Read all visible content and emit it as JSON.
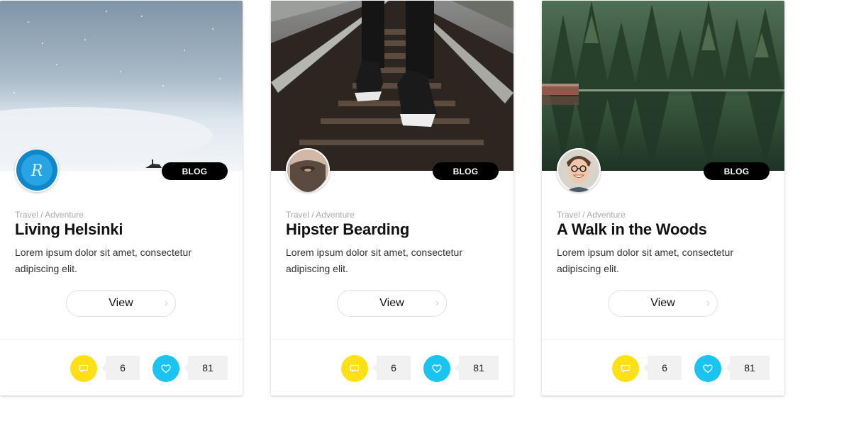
{
  "cards": [
    {
      "tag": "BLOG",
      "category": "Travel / Adventure",
      "title": "Living Helsinki",
      "description": "Lorem ipsum dolor sit amet, consectetur adipiscing elit.",
      "button": "View",
      "comments": "6",
      "likes": "81",
      "photo": "snowy-sky-photo",
      "avatar": "blue-badge-logo"
    },
    {
      "tag": "BLOG",
      "category": "Travel / Adventure",
      "title": "Hipster Bearding",
      "description": "Lorem ipsum dolor sit amet, consectetur adipiscing elit.",
      "button": "View",
      "comments": "6",
      "likes": "81",
      "photo": "railway-sneakers-photo",
      "avatar": "bearded-man-photo"
    },
    {
      "tag": "BLOG",
      "category": "Travel / Adventure",
      "title": "A Walk in the Woods",
      "description": "Lorem ipsum dolor sit amet, consectetur adipiscing elit.",
      "button": "View",
      "comments": "6",
      "likes": "81",
      "photo": "forest-lake-photo",
      "avatar": "smiling-man-photo"
    }
  ],
  "colors": {
    "comment_accent": "#ffe015",
    "like_accent": "#19c4f0",
    "tag_bg": "#000000"
  },
  "icons": {
    "comment": "speech-bubble-icon",
    "like": "heart-icon",
    "chevron": "chevron-right-icon"
  }
}
